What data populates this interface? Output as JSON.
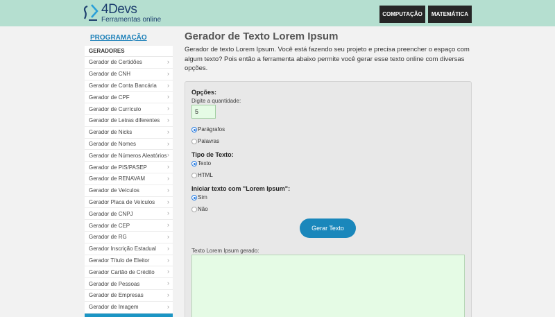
{
  "header": {
    "logo_name": "4Devs",
    "logo_sub": "Ferramentas online",
    "nav": [
      "COMPUTAÇÃO",
      "MATEMÁTICA"
    ]
  },
  "sidebar": {
    "section": "PROGRAMAÇÃO",
    "heading": "GERADORES",
    "items": [
      "Gerador de Certidões",
      "Gerador de CNH",
      "Gerador de Conta Bancária",
      "Gerador de CPF",
      "Gerador de Currículo",
      "Gerador de Letras diferentes",
      "Gerador de Nicks",
      "Gerador de Nomes",
      "Gerador de Números Aleatórios",
      "Gerador de PIS/PASEP",
      "Gerador de RENAVAM",
      "Gerador de Veículos",
      "Gerador Placa de Veículos",
      "Gerador de CNPJ",
      "Gerador de CEP",
      "Gerador de RG",
      "Gerador Inscrição Estadual",
      "Gerador Título de Eleitor",
      "Gerador Cartão de Crédito",
      "Gerador de Pessoas",
      "Gerador de Empresas",
      "Gerador de Imagem"
    ]
  },
  "main": {
    "title": "Gerador de Texto Lorem Ipsum",
    "description": "Gerador de texto Lorem Ipsum. Você está fazendo seu projeto e precisa preencher o espaço com algum texto? Pois então a ferramenta abaixo permite você gerar esse texto online com diversas opções.",
    "options_label": "Opções:",
    "quantity_label": "Digite a quantidade:",
    "quantity_value": "5",
    "unit_options": [
      "Parágrafos",
      "Palavras"
    ],
    "text_type_label": "Tipo de Texto:",
    "text_type_options": [
      "Texto",
      "HTML"
    ],
    "start_label": "Iniciar texto com \"Lorem Ipsum\":",
    "start_options": [
      "Sim",
      "Não"
    ],
    "generate_button": "Gerar Texto",
    "output_label": "Texto Lorem Ipsum gerado:"
  },
  "colors": {
    "header_bg": "#b5dfd0",
    "accent": "#1a87bb",
    "field_bg": "#e5fbe5"
  }
}
